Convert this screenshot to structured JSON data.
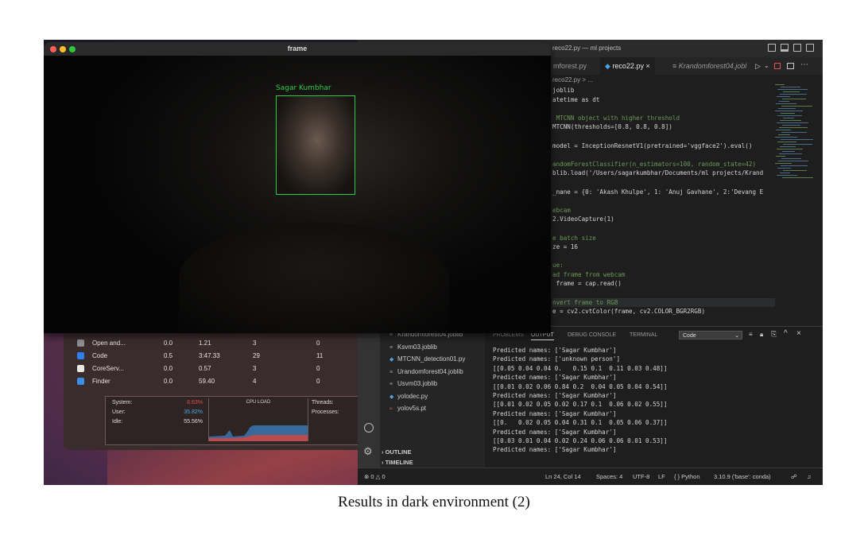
{
  "frame_window": {
    "title": "frame",
    "face_label": "Sagar Kumbhar"
  },
  "activity_monitor": {
    "rows": [
      {
        "name": "Open and...",
        "cpu": "0.0",
        "time": "1.21",
        "threads": "3",
        "wakeups": "0",
        "icon_color": "#8e8e93"
      },
      {
        "name": "Code",
        "cpu": "0.5",
        "time": "3:47.33",
        "threads": "29",
        "wakeups": "11",
        "icon_color": "#2f80ed"
      },
      {
        "name": "CoreServ...",
        "cpu": "0.0",
        "time": "0.57",
        "threads": "3",
        "wakeups": "0",
        "icon_color": "#e8e8e8"
      },
      {
        "name": "Finder",
        "cpu": "0.0",
        "time": "59.40",
        "threads": "4",
        "wakeups": "0",
        "icon_color": "#3a8ee6"
      }
    ],
    "stats": {
      "system_label": "System:",
      "system_value": "8.63%",
      "user_label": "User:",
      "user_value": "35.82%",
      "idle_label": "Idle:",
      "idle_value": "55.56%",
      "cpu_load_label": "CPU LOAD",
      "threads_label": "Threads:",
      "processes_label": "Processes:"
    },
    "colors": {
      "system": "#e05050",
      "user": "#4aa8e8"
    }
  },
  "vscode": {
    "window_title": "reco22.py — ml projects",
    "tabs": [
      {
        "label": "mforest.py",
        "active": false
      },
      {
        "label": "reco22.py ×",
        "active": true
      },
      {
        "label": "≡ Krandomforest04.jobl",
        "active": false
      }
    ],
    "breadcrumb": "reco22.py > ...",
    "code_lines": [
      {
        "text": "joblib",
        "kind": "code"
      },
      {
        "text": "atetime as dt",
        "kind": "code"
      },
      {
        "text": "",
        "kind": "code"
      },
      {
        "text": " MTCNN object with higher threshold",
        "kind": "comment"
      },
      {
        "text": "MTCNN(thresholds=[0.8, 0.8, 0.8])",
        "kind": "code"
      },
      {
        "text": "",
        "kind": "code"
      },
      {
        "text": "model = InceptionResnetV1(pretrained='vggface2').eval()",
        "kind": "code"
      },
      {
        "text": "",
        "kind": "code"
      },
      {
        "text": "andomForestClassifier(n_estimators=100, random_state=42)",
        "kind": "comment"
      },
      {
        "text": "blib.load('/Users/sagarkumbhar/Documents/ml projects/Krand",
        "kind": "code"
      },
      {
        "text": "",
        "kind": "code"
      },
      {
        "text": "_nane = {0: 'Akash Khulpe', 1: 'Anuj Gavhane', 2:'Devang E",
        "kind": "code"
      },
      {
        "text": "",
        "kind": "code"
      },
      {
        "text": "ebcam",
        "kind": "comment"
      },
      {
        "text": "2.VideoCapture(1)",
        "kind": "code"
      },
      {
        "text": "",
        "kind": "code"
      },
      {
        "text": "e batch size",
        "kind": "comment"
      },
      {
        "text": "ze = 16",
        "kind": "code"
      },
      {
        "text": "",
        "kind": "code"
      },
      {
        "text": "ue:",
        "kind": "comment"
      },
      {
        "text": "ad frame from webcam",
        "kind": "comment"
      },
      {
        "text": " frame = cap.read()",
        "kind": "code"
      },
      {
        "text": "",
        "kind": "code"
      },
      {
        "text": "nvert frame to RGB",
        "kind": "comment"
      },
      {
        "text": "e = cv2.cvtColor(frame, cv2.COLOR_BGR2RGB)",
        "kind": "code"
      }
    ],
    "explorer_files": [
      {
        "icon": "≡",
        "name": "Krandomforest04.joblib"
      },
      {
        "icon": "≡",
        "name": "Ksvm03.joblib"
      },
      {
        "icon": "◆",
        "name": "MTCNN_detection01.py"
      },
      {
        "icon": "≡",
        "name": "Urandomforest04.joblib"
      },
      {
        "icon": "≡",
        "name": "Usvm03.joblib"
      },
      {
        "icon": "◆",
        "name": "yolodec.py"
      },
      {
        "icon": "≈",
        "name": "yolov5s.pt"
      }
    ],
    "outline_label": "OUTLINE",
    "timeline_label": "TIMELINE",
    "panel_tabs": [
      "PROBLEMS",
      "OUTPUT",
      "DEBUG CONSOLE",
      "TERMINAL"
    ],
    "panel_active_tab": "OUTPUT",
    "output_channel": "Code",
    "output_lines": [
      "Predicted names: ['Sagar Kumbhar']",
      "Predicted names: ['unknown person']",
      "[[0.05 0.04 0.04 0.   0.15 0.1  0.11 0.03 0.48]]",
      "Predicted names: ['Sagar Kumbhar']",
      "[[0.01 0.02 0.06 0.84 0.2  0.04 0.05 0.04 0.54]]",
      "Predicted names: ['Sagar Kumbhar']",
      "[[0.01 0.02 0.05 0.02 0.17 0.1  0.06 0.02 0.55]]",
      "Predicted names: ['Sagar Kumbhar']",
      "[[0.   0.02 0.05 0.04 0.31 0.1  0.05 0.06 0.37]]",
      "Predicted names: ['Sagar Kumbhar']",
      "[[0.03 0.01 0.04 0.02 0.24 0.06 0.06 0.01 0.53]]",
      "Predicted names: ['Sagar Kumbhar']"
    ],
    "status": {
      "problems": "⊗ 0 △ 0",
      "cursor": "Ln 24, Col 14",
      "spaces": "Spaces: 4",
      "encoding": "UTF-8",
      "eol": "LF",
      "language": "{ } Python",
      "interpreter": "3.10.9 ('base': conda)"
    }
  },
  "caption": "Results in dark environment (2)"
}
